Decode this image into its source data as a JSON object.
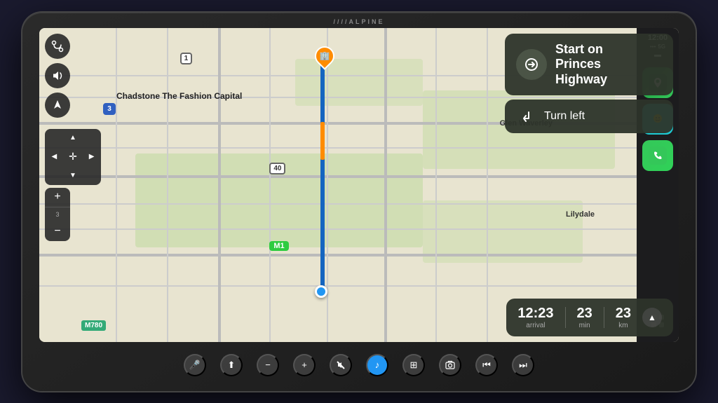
{
  "device": {
    "brand": "////ALPINE"
  },
  "status_bar": {
    "time": "12:00",
    "network": "5G",
    "signal_icon": "▪▪▪▪",
    "battery_icon": "🔋"
  },
  "map": {
    "destination_label": "Chadstone The Fashion Capital",
    "suburb_label": "Glen Waverley",
    "suburb2_label": "Lilydale",
    "road_badge_1": "1",
    "road_badge_3": "3",
    "road_badge_40": "40",
    "highway_m1": "M1",
    "highway_m780": "M780"
  },
  "navigation": {
    "primary_instruction": "Start on\nPrinces\nHighway",
    "primary_instruction_line1": "Start on",
    "primary_instruction_line2": "Princes",
    "primary_instruction_line3": "Highway",
    "secondary_instruction": "Turn left"
  },
  "trip_info": {
    "arrival_time": "12:23",
    "arrival_label": "arrival",
    "duration_value": "23",
    "duration_label": "min",
    "distance_value": "23",
    "distance_label": "km"
  },
  "left_buttons": {
    "route_icon": "⤷",
    "sound_icon": "🔊",
    "location_icon": "◎"
  },
  "right_apps": [
    {
      "name": "Maps",
      "emoji": "🗺"
    },
    {
      "name": "Waze",
      "emoji": "●"
    },
    {
      "name": "Phone",
      "emoji": "📞"
    },
    {
      "name": "Grid",
      "emoji": "⋮⋮⋮"
    }
  ],
  "bottom_controls": {
    "back_icon": "⬆",
    "minus_icon": "−",
    "plus_icon": "+",
    "mute_icon": "🔇",
    "music_icon": "♪",
    "grid_icon": "⊞",
    "camera_icon": "⊙",
    "prev_icon": "⏮",
    "next_icon": "⏭"
  },
  "zoom_controls": {
    "plus_label": "+",
    "badge_3": "3",
    "minus_label": "−"
  }
}
